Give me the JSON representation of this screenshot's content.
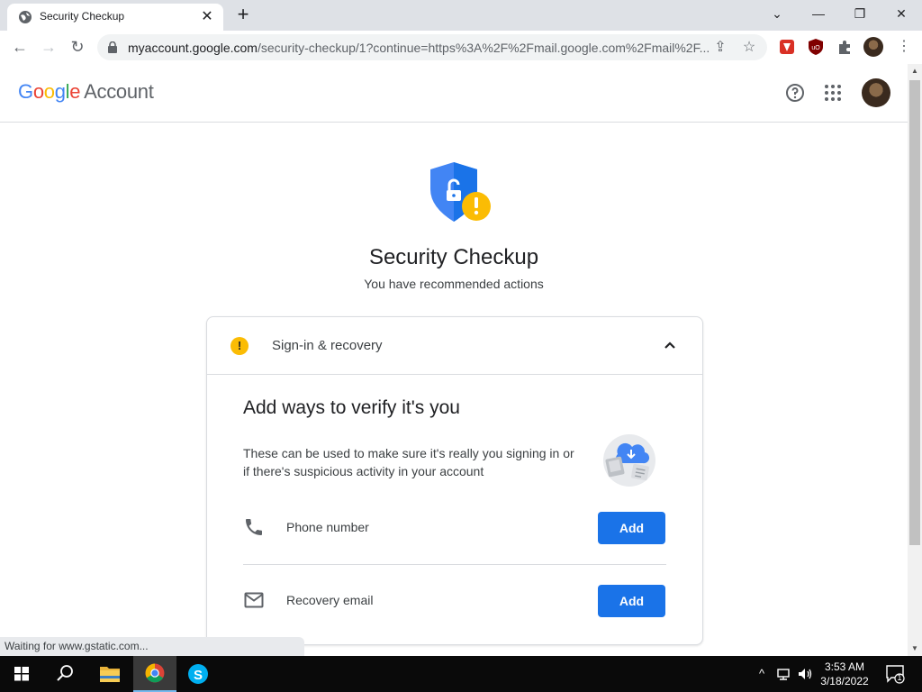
{
  "browser": {
    "tab_title": "Security Checkup",
    "url_host": "myaccount.google.com",
    "url_path": "/security-checkup/1?continue=https%3A%2F%2Fmail.google.com%2Fmail%2F..."
  },
  "header": {
    "logo_google": [
      "G",
      "o",
      "o",
      "g",
      "l",
      "e"
    ],
    "logo_colors": [
      "#4285f4",
      "#ea4335",
      "#fbbc04",
      "#4285f4",
      "#34a853",
      "#ea4335"
    ],
    "logo_account": "Account"
  },
  "page": {
    "title": "Security Checkup",
    "subtitle": "You have recommended actions"
  },
  "card": {
    "section_label": "Sign-in & recovery",
    "heading": "Add ways to verify it's you",
    "description": "These can be used to make sure it's really you signing in or if there's suspicious activity in your account",
    "rows": [
      {
        "label": "Phone number",
        "icon": "phone-icon",
        "button": "Add"
      },
      {
        "label": "Recovery email",
        "icon": "mail-icon",
        "button": "Add"
      }
    ]
  },
  "status_bar": "Waiting for www.gstatic.com...",
  "taskbar": {
    "time": "3:53 AM",
    "date": "3/18/2022",
    "notification_count": "1"
  },
  "colors": {
    "accent_blue": "#1a73e8",
    "warning_yellow": "#fbbc04"
  }
}
